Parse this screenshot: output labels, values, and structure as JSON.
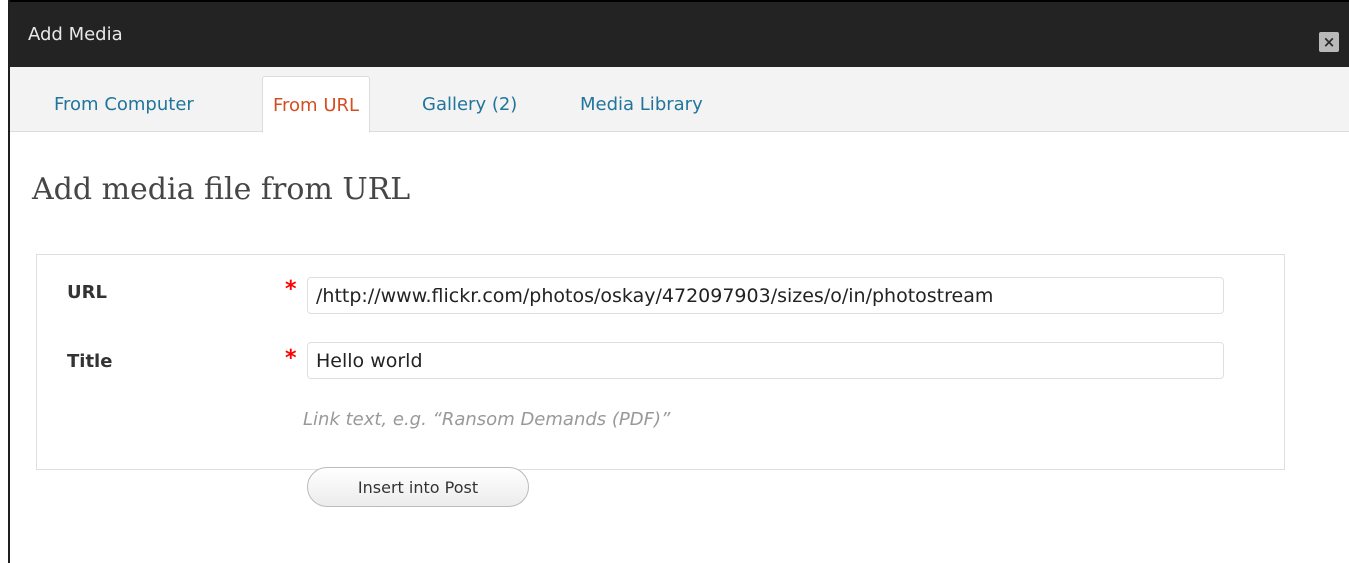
{
  "window": {
    "title": "Add Media",
    "close_icon": "close-icon"
  },
  "tabs": [
    {
      "label": "From Computer",
      "active": false
    },
    {
      "label": "From URL",
      "active": true
    },
    {
      "label": "Gallery (2)",
      "active": false
    },
    {
      "label": "Media Library",
      "active": false
    }
  ],
  "main": {
    "title": "Add media file from URL",
    "fields": {
      "url": {
        "label": "URL",
        "required_mark": "*",
        "value": "http://www.flickr.com/photos/oskay/472097903/sizes/o/in/photostream/"
      },
      "title": {
        "label": "Title",
        "required_mark": "*",
        "value": "Hello world"
      }
    },
    "help_text": "Link text, e.g. “Ransom Demands (PDF)”",
    "insert_button_label": "Insert into Post"
  },
  "colors": {
    "titlebar_bg": "#232323",
    "tab_link": "#21759b",
    "tab_active": "#d54e21",
    "required": "#ff0000"
  }
}
